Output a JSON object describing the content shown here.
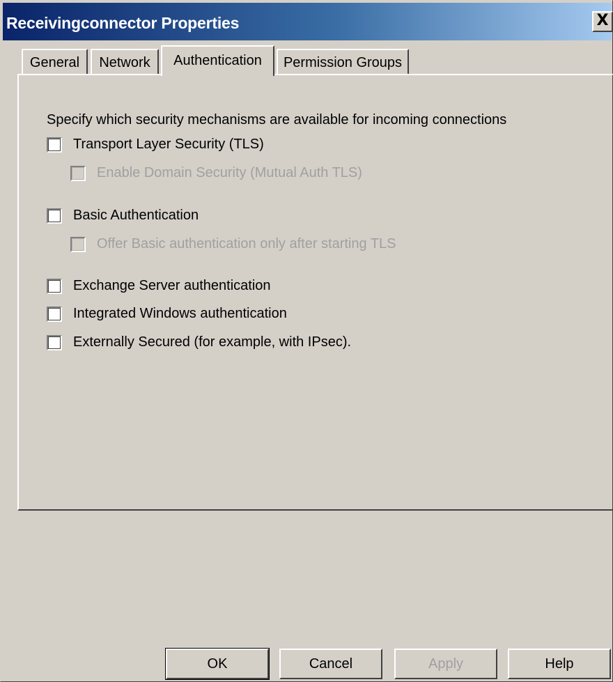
{
  "window": {
    "title": "Receivingconnector Properties",
    "close_glyph": "X"
  },
  "tabs": [
    {
      "label": "General",
      "active": false
    },
    {
      "label": "Network",
      "active": false
    },
    {
      "label": "Authentication",
      "active": true
    },
    {
      "label": "Permission Groups",
      "active": false
    }
  ],
  "panel": {
    "intro": "Specify which security mechanisms are available for incoming connections",
    "options": [
      {
        "label": "Transport Layer Security (TLS)",
        "checked": false,
        "enabled": true
      },
      {
        "label": "Enable Domain Security (Mutual Auth TLS)",
        "checked": false,
        "enabled": false
      },
      {
        "label": "Basic Authentication",
        "checked": false,
        "enabled": true
      },
      {
        "label": "Offer Basic authentication only after starting TLS",
        "checked": false,
        "enabled": false
      },
      {
        "label": "Exchange Server authentication",
        "checked": false,
        "enabled": true
      },
      {
        "label": "Integrated Windows authentication",
        "checked": false,
        "enabled": true
      },
      {
        "label": "Externally Secured (for example, with IPsec).",
        "checked": false,
        "enabled": true
      }
    ]
  },
  "buttons": {
    "ok": "OK",
    "cancel": "Cancel",
    "apply": "Apply",
    "help": "Help"
  },
  "colors": {
    "dialog_bg": "#d4d0c8",
    "titlebar_start": "#0a246a",
    "titlebar_end": "#a6caf0",
    "disabled_text": "#a0a0a0"
  }
}
